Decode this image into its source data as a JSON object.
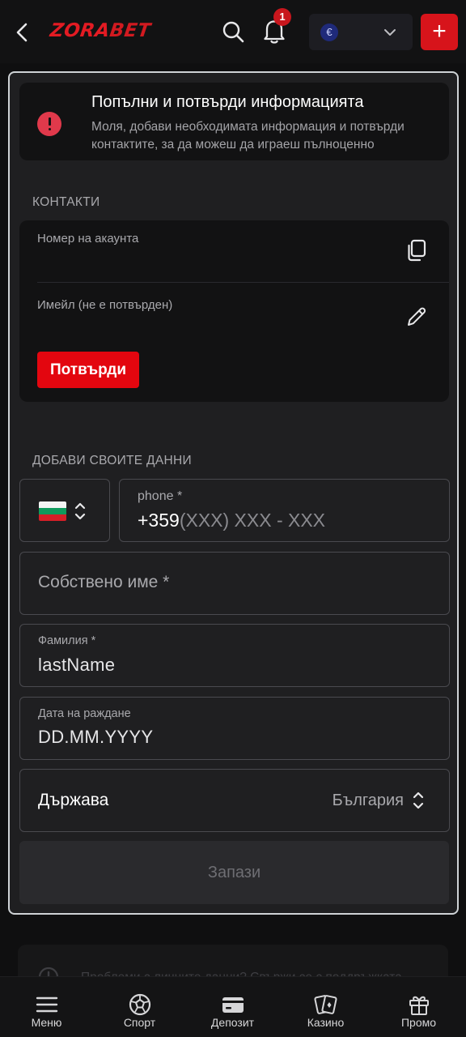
{
  "header": {
    "logo_part1": "ZORA",
    "logo_part2": "BET",
    "notification_count": "1",
    "currency_symbol": "€",
    "deposit_plus": "+"
  },
  "alert": {
    "title": "Попълни и потвърди информацията",
    "text": "Моля, добави необходимата информация и потвърди контактите, за да можеш да играеш пълноценно"
  },
  "contacts": {
    "section_label": "КОНТАКТИ",
    "account_label": "Номер на акаунта",
    "email_label": "Имейл (не е потвърден)",
    "confirm_button": "Потвърди"
  },
  "personal": {
    "section_label": "ДОБАВИ СВОИТЕ ДАННИ",
    "phone_label": "phone *",
    "phone_prefix": "+359",
    "phone_mask": "(XXX) XXX - XXX",
    "first_name_placeholder": "Собствено име *",
    "last_name_label": "Фамилия *",
    "last_name_value": "lastName",
    "birthdate_label": "Дата на раждане",
    "birthdate_value": "DD.MM.YYYY",
    "country_label": "Държава",
    "country_value": "България",
    "save_button": "Запази"
  },
  "help": {
    "text": "Проблеми с личните данни? Свържи се с поддръжката"
  },
  "bottom_nav": {
    "items": [
      {
        "label": "Меню",
        "icon": "menu-icon"
      },
      {
        "label": "Спорт",
        "icon": "soccer-ball-icon"
      },
      {
        "label": "Депозит",
        "icon": "wallet-icon"
      },
      {
        "label": "Казино",
        "icon": "cards-icon"
      },
      {
        "label": "Промо",
        "icon": "gift-icon"
      }
    ]
  },
  "colors": {
    "accent_red": "#e3060f",
    "background": "#0f0f10",
    "modal_bg": "#1f1f21",
    "card_bg": "#121213"
  }
}
